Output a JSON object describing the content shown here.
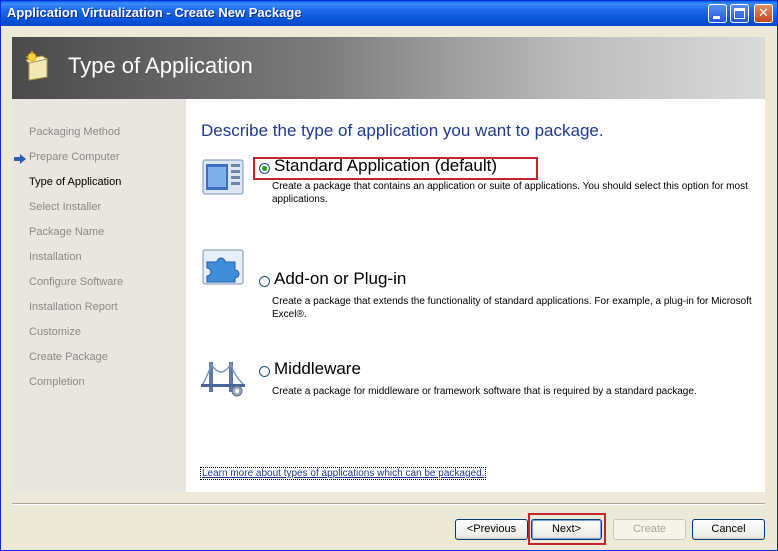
{
  "window": {
    "title": "Application Virtualization - Create New Package"
  },
  "banner": {
    "title": "Type of Application"
  },
  "nav": {
    "items": [
      {
        "label": "Packaging Method",
        "active": false
      },
      {
        "label": "Prepare Computer",
        "active": false
      },
      {
        "label": "Type of Application",
        "active": true
      },
      {
        "label": "Select Installer",
        "active": false
      },
      {
        "label": "Package Name",
        "active": false
      },
      {
        "label": "Installation",
        "active": false
      },
      {
        "label": "Configure Software",
        "active": false
      },
      {
        "label": "Installation Report",
        "active": false
      },
      {
        "label": "Customize",
        "active": false
      },
      {
        "label": "Create Package",
        "active": false
      },
      {
        "label": "Completion",
        "active": false
      }
    ]
  },
  "main": {
    "heading": "Describe the type of application you want to package.",
    "options": [
      {
        "label": "Standard Application (default)",
        "description": "Create a package that contains an application or suite of applications. You should select this option for most applications.",
        "selected": true,
        "icon": "application-window-icon"
      },
      {
        "label": "Add-on or Plug-in",
        "description": "Create a package that extends the functionality of standard applications. For example, a plug-in for Microsoft Excel®.",
        "selected": false,
        "icon": "puzzle-piece-icon"
      },
      {
        "label": "Middleware",
        "description": "Create a package for middleware or framework software that is required by a standard package.",
        "selected": false,
        "icon": "bridge-icon"
      }
    ],
    "learn_more_link": "Learn more about types of applications which can be packaged."
  },
  "buttons": {
    "previous": "<Previous",
    "next": "Next>",
    "create": "Create",
    "cancel": "Cancel"
  },
  "colors": {
    "titlebar": "#0A55DA",
    "heading": "#1F3A93",
    "highlight": "#C0272D",
    "radio_selected": "#21A121"
  }
}
